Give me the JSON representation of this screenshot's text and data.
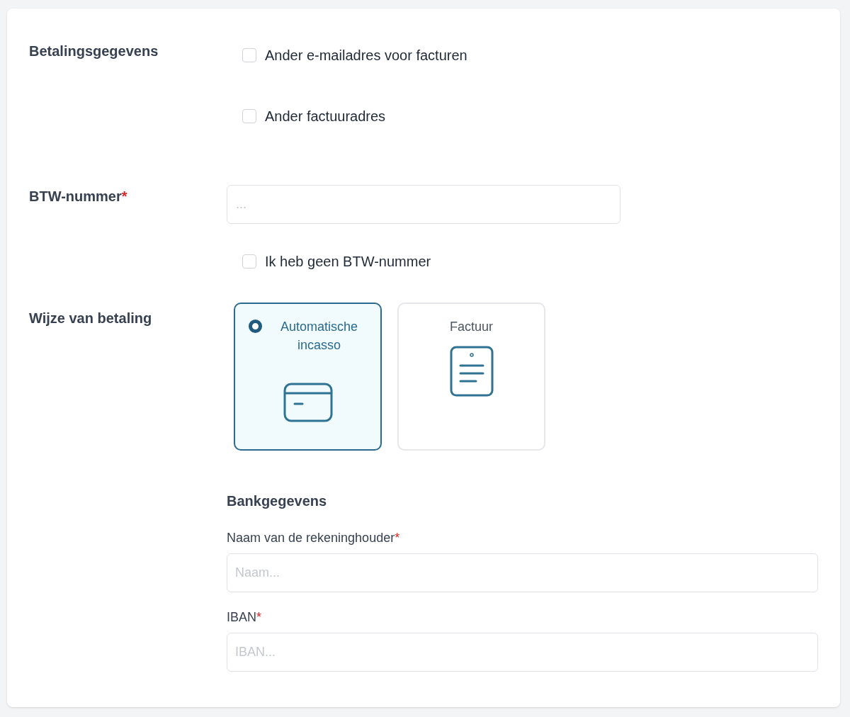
{
  "billing": {
    "label": "Betalingsgegevens",
    "options": [
      {
        "label": "Ander e-mailadres voor facturen",
        "checked": false
      },
      {
        "label": "Ander factuuradres",
        "checked": false
      }
    ]
  },
  "vat": {
    "label": "BTW-nummer",
    "required_mark": "*",
    "placeholder": "...",
    "no_vat": {
      "label": "Ik heb geen BTW-nummer",
      "checked": false
    }
  },
  "payment_method": {
    "label": "Wijze van betaling",
    "options": [
      {
        "kind": "card",
        "label": "Automatische incasso",
        "selected": true
      },
      {
        "kind": "invoice",
        "label": "Factuur",
        "selected": false
      }
    ]
  },
  "bank_details": {
    "title": "Bankgegevens",
    "fields": [
      {
        "label": "Naam van de rekeninghouder",
        "required_mark": "*",
        "placeholder": "Naam..."
      },
      {
        "label": "IBAN",
        "required_mark": "*",
        "placeholder": "IBAN..."
      }
    ]
  }
}
